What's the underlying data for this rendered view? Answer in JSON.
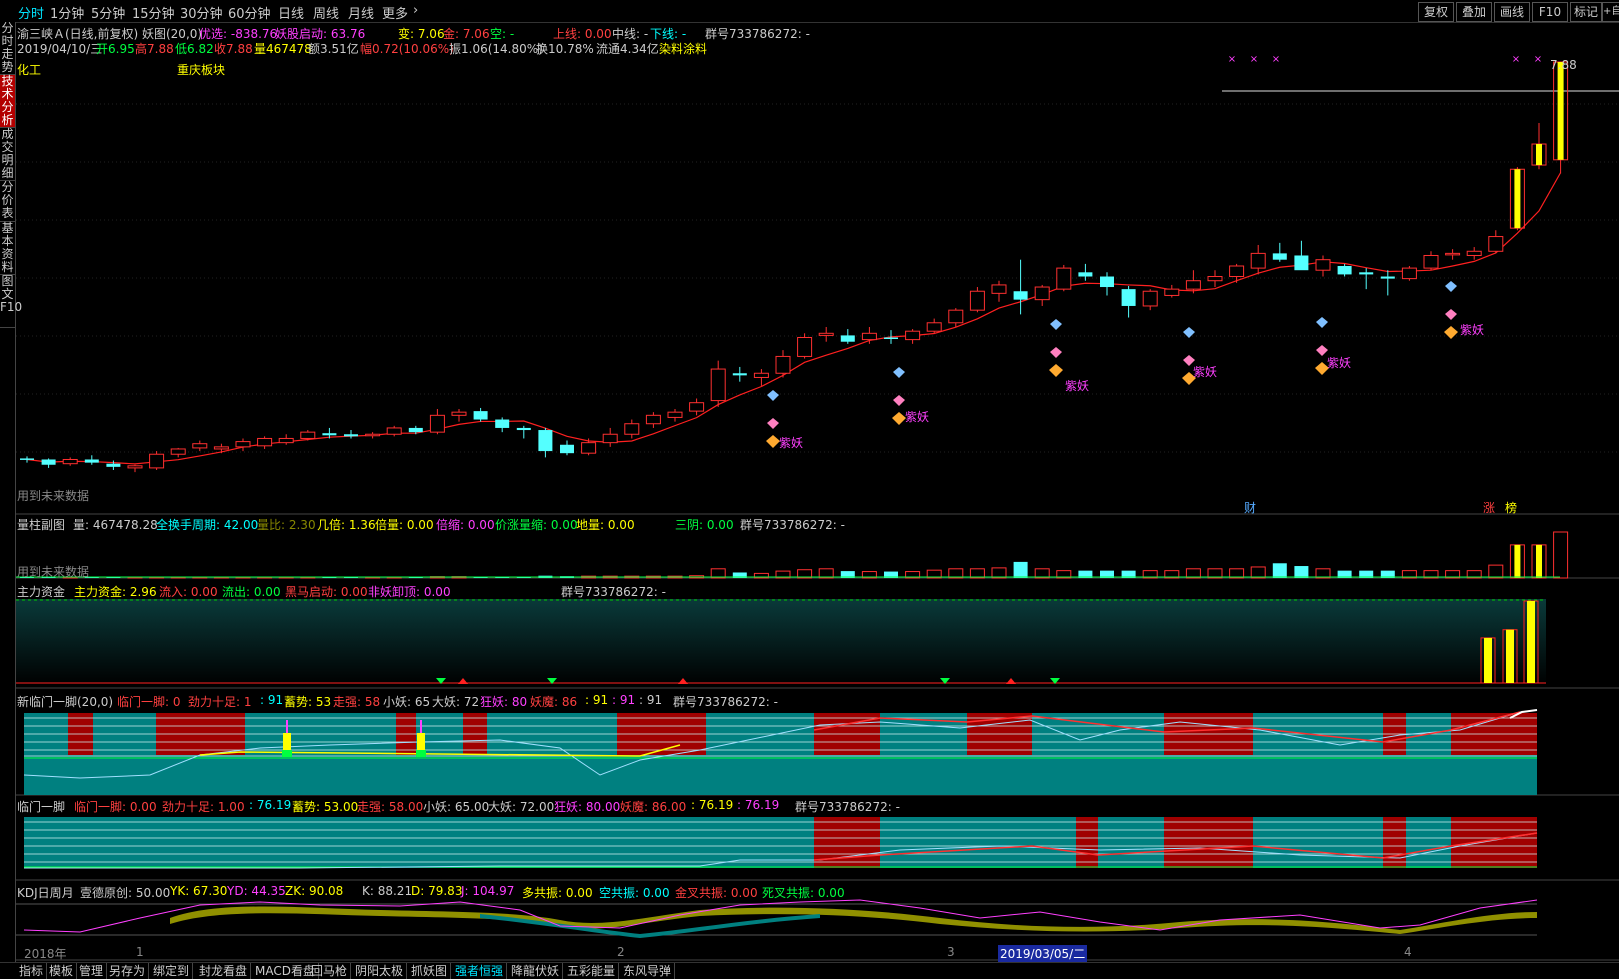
{
  "toolbar": {
    "tabs": [
      "分时",
      "1分钟",
      "5分钟",
      "15分钟",
      "30分钟",
      "60分钟",
      "日线",
      "周线",
      "月线",
      "更多"
    ],
    "right_buttons": [
      "复权",
      "叠加",
      "画线",
      "F10",
      "标记",
      "+自"
    ]
  },
  "sidebar": [
    "分时走势",
    "技术分析",
    "成交明细",
    "分价表",
    "基本资料",
    "图文F10"
  ],
  "header": {
    "title": "渝三峡Ａ(日线,前复权) 妖图(20,0)",
    "youxuan": "优选: -838.76",
    "yaogu": "妖股启动: 63.76",
    "bian": "变: 7.06",
    "jin": "金: 7.06",
    "kong": "空: -",
    "shangxian": "上线: 0.00",
    "zhongxian": "中线: -",
    "xiaxian": "下线: -",
    "qun": "群号733786272: -",
    "date": "2019/04/10/三",
    "open": "开6.95",
    "high": "高7.88",
    "low": "低6.82",
    "close": "收7.88",
    "vol": "量467478",
    "amount": "额3.51亿",
    "change": "幅0.72(10.06%)",
    "amp": "振1.06(14.80%)",
    "turn": "换10.78%",
    "float": "流通4.34亿",
    "sector": "染料涂料",
    "industry": "化工",
    "region": "重庆板块",
    "max_price": "7.88",
    "future_note": "用到未来数据",
    "label_cai": "财",
    "label_zhang": "涨",
    "label_bang": "榜",
    "ziyao": "紫妖"
  },
  "vol_panel": {
    "title": "量柱副图",
    "liang": "量: 467478.28",
    "quanhuan": "全换手周期: 42.00",
    "liangbi": "量比: 2.30",
    "jibei": "几倍: 1.36",
    "beiliang": "倍量: 0.00",
    "beisuo": "倍缩: 0.00",
    "jiazhang": "价涨量缩: 0.00",
    "diliang": "地量: 0.00",
    "sanyin": "三阴: 0.00",
    "qun": "群号733786272: -",
    "future_note": "用到未来数据"
  },
  "fund_panel": {
    "title": "主力资金",
    "zhuli": "主力资金: 2.96",
    "liuru": "流入: 0.00",
    "liuchu": "流出: 0.00",
    "heima": "黑马启动: 0.00",
    "feiyao": "非妖卸顶: 0.00",
    "qun": "群号733786272: -"
  },
  "lm1_panel": {
    "title": "新临门一脚(20,0)",
    "a": "临门一脚: 0",
    "b": "劲力十足: 1",
    "c": ": 91",
    "d": "蓄势: 53",
    "e": "走强: 58",
    "f": "小妖: 65",
    "g": "大妖: 72",
    "h": "狂妖: 80",
    "i": "妖魔: 86",
    "j": ": 91",
    "k": ": 91",
    "l": ": 91",
    "qun": "群号733786272: -"
  },
  "lm2_panel": {
    "title": "临门一脚",
    "a": "临门一脚: 0.00",
    "b": "劲力十足: 1.00",
    "c": ": 76.19",
    "d": "蓄势: 53.00",
    "e": "走强: 58.00",
    "f": "小妖: 65.00",
    "g": "大妖: 72.00",
    "h": "狂妖: 80.00",
    "i": "妖魔: 86.00",
    "j": ": 76.19",
    "k": ": 76.19",
    "qun": "群号733786272: -"
  },
  "kdj_panel": {
    "title": "KDJ日周月",
    "brand": "壹德原创: 50.00",
    "yk": "YK: 67.30",
    "yd": "YD: 44.35",
    "zk": "ZK: 90.08",
    "k": "K: 88.21",
    "d": "D: 79.83",
    "j": "J: 104.97",
    "duo": "多共振: 0.00",
    "kong": "空共振: 0.00",
    "jincha": "金叉共振: 0.00",
    "sicha": "死叉共振: 0.00"
  },
  "axis": {
    "year": "2018年",
    "m1": "1",
    "m2": "2",
    "m3": "3",
    "m4": "4",
    "cursor_date": "2019/03/05/二"
  },
  "bottom_tabs": [
    "指标",
    "模板",
    "管理",
    "另存为",
    "绑定到",
    "封龙看盘",
    "MACD看盘",
    "回马枪",
    "阴阳太极",
    "抓妖图",
    "强者恒强",
    "降龍伏妖",
    "五彩能量",
    "东风导弹"
  ],
  "chart_data": {
    "type": "candlestick",
    "ohlc": [
      [
        4.11,
        4.13,
        4.07,
        4.1
      ],
      [
        4.1,
        4.11,
        4.02,
        4.05
      ],
      [
        4.06,
        4.12,
        4.04,
        4.1
      ],
      [
        4.1,
        4.14,
        4.05,
        4.07
      ],
      [
        4.06,
        4.09,
        4.0,
        4.03
      ],
      [
        4.02,
        4.05,
        3.98,
        4.04
      ],
      [
        4.02,
        4.18,
        4.0,
        4.15
      ],
      [
        4.15,
        4.21,
        4.12,
        4.2
      ],
      [
        4.21,
        4.28,
        4.18,
        4.25
      ],
      [
        4.2,
        4.25,
        4.16,
        4.22
      ],
      [
        4.22,
        4.3,
        4.18,
        4.27
      ],
      [
        4.23,
        4.32,
        4.2,
        4.3
      ],
      [
        4.26,
        4.34,
        4.24,
        4.3
      ],
      [
        4.3,
        4.38,
        4.28,
        4.36
      ],
      [
        4.35,
        4.4,
        4.3,
        4.33
      ],
      [
        4.34,
        4.38,
        4.3,
        4.32
      ],
      [
        4.33,
        4.36,
        4.3,
        4.34
      ],
      [
        4.34,
        4.42,
        4.32,
        4.4
      ],
      [
        4.4,
        4.42,
        4.34,
        4.36
      ],
      [
        4.36,
        4.58,
        4.34,
        4.52
      ],
      [
        4.52,
        4.58,
        4.46,
        4.55
      ],
      [
        4.56,
        4.59,
        4.46,
        4.48
      ],
      [
        4.48,
        4.5,
        4.36,
        4.4
      ],
      [
        4.4,
        4.42,
        4.3,
        4.38
      ],
      [
        4.38,
        4.4,
        4.12,
        4.18
      ],
      [
        4.24,
        4.28,
        4.14,
        4.16
      ],
      [
        4.16,
        4.3,
        4.14,
        4.26
      ],
      [
        4.26,
        4.4,
        4.22,
        4.34
      ],
      [
        4.34,
        4.48,
        4.3,
        4.44
      ],
      [
        4.44,
        4.55,
        4.4,
        4.52
      ],
      [
        4.5,
        4.58,
        4.46,
        4.55
      ],
      [
        4.56,
        4.68,
        4.52,
        4.64
      ],
      [
        4.66,
        5.04,
        4.6,
        4.96
      ],
      [
        4.92,
        4.98,
        4.84,
        4.9
      ],
      [
        4.88,
        4.96,
        4.8,
        4.92
      ],
      [
        4.92,
        5.14,
        4.88,
        5.08
      ],
      [
        5.08,
        5.3,
        5.06,
        5.26
      ],
      [
        5.28,
        5.36,
        5.22,
        5.3
      ],
      [
        5.28,
        5.34,
        5.2,
        5.22
      ],
      [
        5.24,
        5.36,
        5.2,
        5.3
      ],
      [
        5.26,
        5.33,
        5.2,
        5.25
      ],
      [
        5.24,
        5.34,
        5.2,
        5.32
      ],
      [
        5.32,
        5.44,
        5.3,
        5.4
      ],
      [
        5.4,
        5.54,
        5.36,
        5.52
      ],
      [
        5.52,
        5.74,
        5.5,
        5.7
      ],
      [
        5.68,
        5.8,
        5.6,
        5.76
      ],
      [
        5.7,
        6.0,
        5.48,
        5.62
      ],
      [
        5.62,
        5.76,
        5.56,
        5.74
      ],
      [
        5.72,
        5.95,
        5.7,
        5.92
      ],
      [
        5.88,
        5.96,
        5.8,
        5.84
      ],
      [
        5.84,
        5.88,
        5.66,
        5.74
      ],
      [
        5.72,
        5.75,
        5.45,
        5.56
      ],
      [
        5.56,
        5.72,
        5.52,
        5.7
      ],
      [
        5.66,
        5.76,
        5.64,
        5.72
      ],
      [
        5.72,
        5.9,
        5.68,
        5.8
      ],
      [
        5.8,
        5.9,
        5.74,
        5.84
      ],
      [
        5.84,
        5.96,
        5.78,
        5.94
      ],
      [
        5.92,
        6.14,
        5.86,
        6.06
      ],
      [
        6.06,
        6.16,
        5.98,
        6.0
      ],
      [
        6.04,
        6.18,
        6.0,
        5.9
      ],
      [
        5.9,
        6.04,
        5.84,
        6.0
      ],
      [
        5.94,
        5.96,
        5.84,
        5.86
      ],
      [
        5.88,
        5.92,
        5.72,
        5.86
      ],
      [
        5.84,
        5.9,
        5.66,
        5.82
      ],
      [
        5.82,
        5.94,
        5.8,
        5.92
      ],
      [
        5.92,
        6.08,
        5.9,
        6.04
      ],
      [
        6.06,
        6.1,
        6.0,
        6.06
      ],
      [
        6.04,
        6.12,
        6.0,
        6.08
      ],
      [
        6.08,
        6.28,
        6.06,
        6.22
      ],
      [
        6.3,
        6.88,
        6.28,
        6.86
      ],
      [
        6.9,
        7.3,
        6.86,
        7.1
      ],
      [
        6.95,
        7.88,
        6.82,
        7.88
      ]
    ],
    "price_range": [
      4.0,
      7.88
    ],
    "volume_levels": [
      0.02,
      0.02,
      0.02,
      0.02,
      0.02,
      0.02,
      0.02,
      0.02,
      0.02,
      0.02,
      0.02,
      0.02,
      0.02,
      0.02,
      0.02,
      0.02,
      0.02,
      0.02,
      0.02,
      0.03,
      0.03,
      0.03,
      0.03,
      0.03,
      0.05,
      0.04,
      0.04,
      0.04,
      0.04,
      0.04,
      0.04,
      0.05,
      0.2,
      0.12,
      0.1,
      0.15,
      0.18,
      0.2,
      0.15,
      0.14,
      0.14,
      0.14,
      0.17,
      0.2,
      0.2,
      0.22,
      0.35,
      0.2,
      0.16,
      0.16,
      0.16,
      0.16,
      0.16,
      0.16,
      0.2,
      0.2,
      0.2,
      0.24,
      0.32,
      0.26,
      0.2,
      0.16,
      0.16,
      0.16,
      0.16,
      0.16,
      0.16,
      0.16,
      0.28,
      0.72,
      0.72,
      1.0
    ],
    "ma_color": "#ff2020",
    "up_color": "#ff3030",
    "down_color": "#54ffff"
  }
}
